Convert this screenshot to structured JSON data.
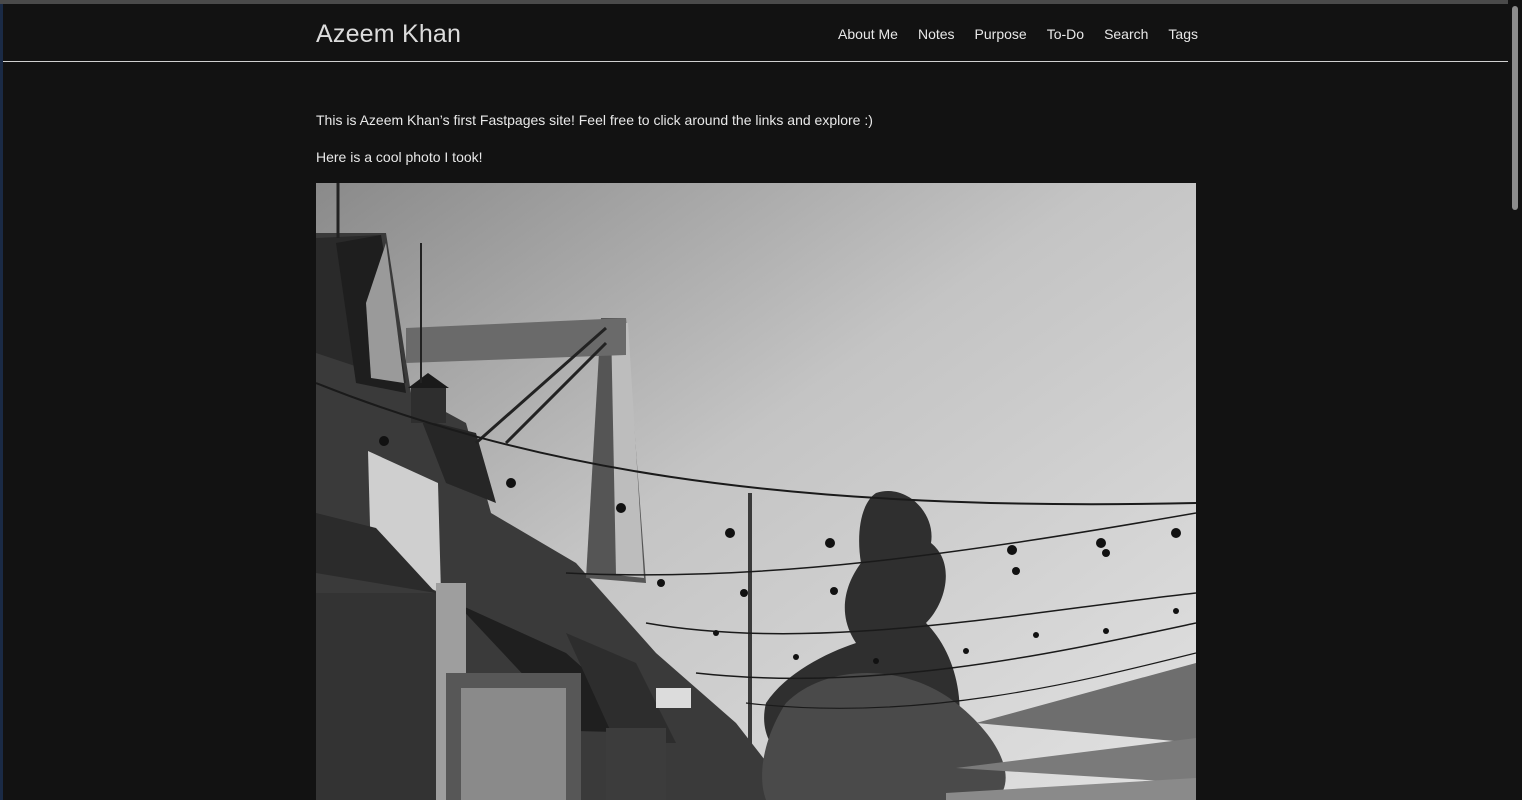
{
  "site": {
    "title": "Azeem Khan"
  },
  "nav": {
    "items": [
      {
        "label": "About Me"
      },
      {
        "label": "Notes"
      },
      {
        "label": "Purpose"
      },
      {
        "label": "To-Do"
      },
      {
        "label": "Search"
      },
      {
        "label": "Tags"
      }
    ]
  },
  "content": {
    "intro": "This is Azeem Khan’s first Fastpages site! Feel free to click around the links and explore :)",
    "photo_caption": "Here is a cool photo I took!"
  },
  "colors": {
    "background": "#121212",
    "text": "#e8e8e8",
    "rule": "#d0d0d0"
  }
}
